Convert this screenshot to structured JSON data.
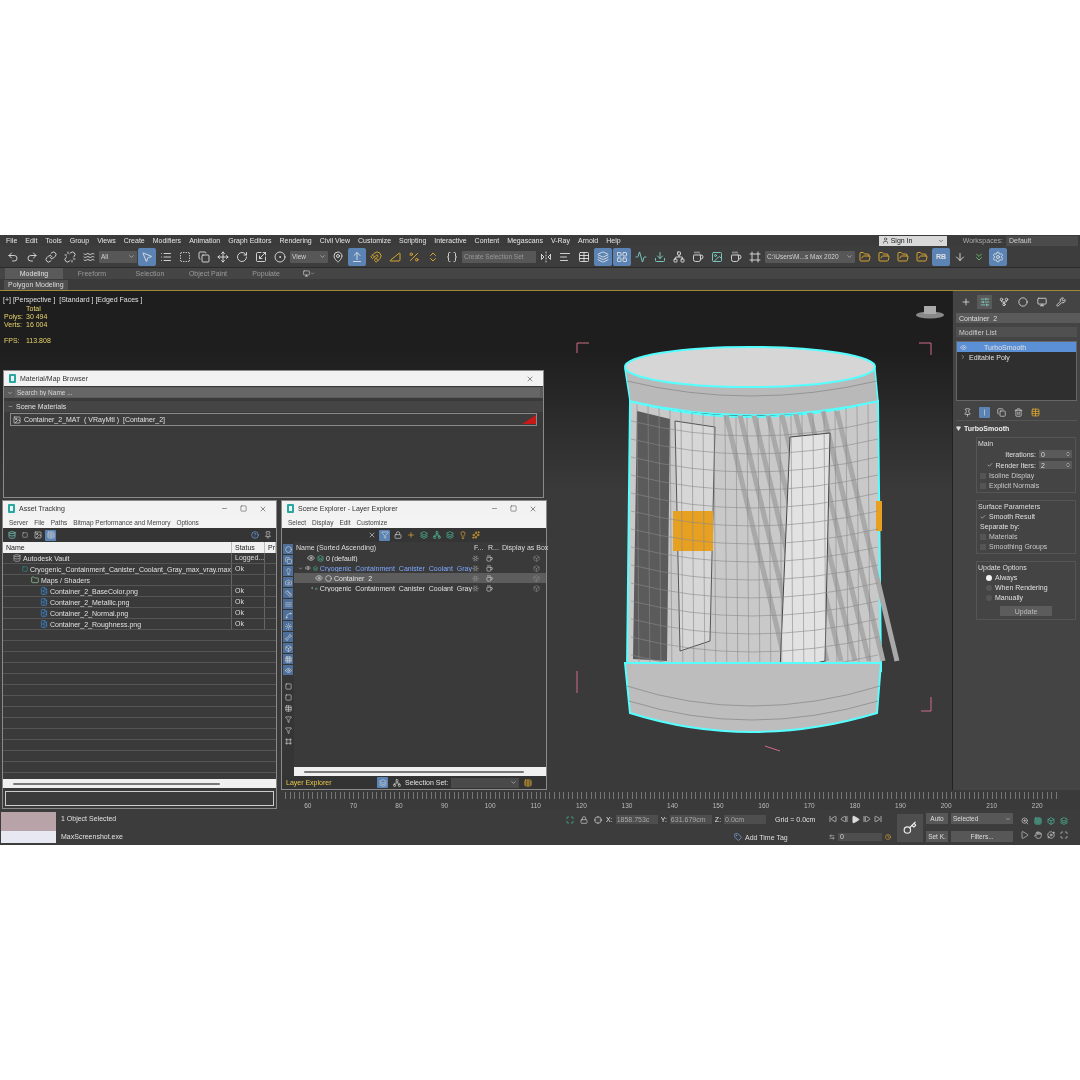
{
  "menu": [
    "File",
    "Edit",
    "Tools",
    "Group",
    "Views",
    "Create",
    "Modifiers",
    "Animation",
    "Graph Editors",
    "Rendering",
    "Civil View",
    "Customize",
    "Scripting",
    "Interactive",
    "Content",
    "Megascans",
    "V-Ray",
    "Arnold",
    "Help"
  ],
  "sign_in": "Sign In",
  "workspaces": {
    "label": "Workspaces:",
    "value": "Default"
  },
  "toolbar": [
    {
      "kind": "undo",
      "on": false
    },
    {
      "kind": "redo",
      "on": false
    },
    {
      "kind": "link",
      "on": false
    },
    {
      "kind": "unlink",
      "on": false
    },
    {
      "kind": "bind",
      "on": false
    },
    {
      "kind": "dropdown",
      "value": "All",
      "on": false
    },
    {
      "kind": "select",
      "on": true
    },
    {
      "kind": "select_by_name",
      "on": false
    },
    {
      "kind": "region",
      "on": false
    },
    {
      "kind": "crossing",
      "on": false
    },
    {
      "kind": "move",
      "on": false
    },
    {
      "kind": "rotate",
      "on": false
    },
    {
      "kind": "scale",
      "on": false
    },
    {
      "kind": "place",
      "on": false
    },
    {
      "kind": "dropdown",
      "value": "View",
      "on": false
    },
    {
      "kind": "pivot",
      "on": false
    },
    {
      "kind": "manipulate",
      "on": true
    },
    {
      "kind": "snap",
      "on": false
    },
    {
      "kind": "angle_snap",
      "on": false
    },
    {
      "kind": "percent_snap",
      "on": false
    },
    {
      "kind": "spinner_snap",
      "on": false
    },
    {
      "kind": "named_sets",
      "on": false
    },
    {
      "kind": "combo",
      "placeholder": "Create Selection Set",
      "on": false
    },
    {
      "kind": "mirror",
      "on": false
    },
    {
      "kind": "align",
      "on": false
    },
    {
      "kind": "table",
      "on": false
    },
    {
      "kind": "layers",
      "on": true
    },
    {
      "kind": "grid",
      "on": true
    },
    {
      "kind": "curve",
      "on": false
    },
    {
      "kind": "dope",
      "on": false
    },
    {
      "kind": "schematic",
      "on": false
    },
    {
      "kind": "teapot",
      "on": false
    },
    {
      "kind": "image",
      "on": false
    },
    {
      "kind": "teapot",
      "on": false
    },
    {
      "kind": "frame",
      "on": false
    },
    {
      "kind": "dropdown",
      "value": "C:\\Users\\M...s Max 2020",
      "on": false
    },
    {
      "kind": "folder",
      "on": false
    },
    {
      "kind": "folder",
      "on": false
    },
    {
      "kind": "folder",
      "on": false
    },
    {
      "kind": "folder",
      "on": false
    },
    {
      "kind": "badge",
      "label": "RB",
      "on": true
    },
    {
      "kind": "down",
      "on": false
    },
    {
      "kind": "chevrons",
      "on": false
    },
    {
      "kind": "settings",
      "on": true
    }
  ],
  "ribbon_tabs": [
    {
      "label": "Modeling",
      "selected": true
    },
    {
      "label": "Freeform",
      "selected": false
    },
    {
      "label": "Selection",
      "selected": false
    },
    {
      "label": "Object Paint",
      "selected": false
    },
    {
      "label": "Populate",
      "selected": false
    }
  ],
  "ribbon_panel": "Polygon Modeling",
  "viewport": {
    "label": "[+] [Perspective ]  [Standard ] [Edged Faces ]",
    "stats_header": "Total",
    "stats": [
      {
        "label": "Polys:",
        "value": "30 494"
      },
      {
        "label": "Verts:",
        "value": "16 004"
      },
      {
        "label": "FPS:",
        "value": "113.808"
      }
    ]
  },
  "material_browser": {
    "title": "Material/Map Browser",
    "search_placeholder": "Search by Name ...",
    "group": "Scene Materials",
    "materials": [
      "Container_2_MAT  ( VRayMtl )  [Container_2]"
    ]
  },
  "asset_tracking": {
    "title": "Asset Tracking",
    "menu": [
      "Server",
      "File",
      "Paths",
      "Bitmap Performance and Memory",
      "Options"
    ],
    "columns": [
      "Name",
      "Status",
      "Pr"
    ],
    "tree": [
      {
        "name": "Autodesk Vault",
        "kind": "vault",
        "status": "Logged...",
        "children": [
          {
            "name": "Cryogenic_Containment_Canister_Coolant_Gray_max_vray.max",
            "kind": "scene",
            "status": "Ok",
            "children": [
              {
                "name": "Maps / Shaders",
                "kind": "folder",
                "children": [
                  {
                    "name": "Container_2_BaseColor.png",
                    "kind": "image",
                    "status": "Ok"
                  },
                  {
                    "name": "Container_2_Metallic.png",
                    "kind": "image",
                    "status": "Ok"
                  },
                  {
                    "name": "Container_2_Normal.png",
                    "kind": "image",
                    "status": "Ok"
                  },
                  {
                    "name": "Container_2_Roughness.png",
                    "kind": "image",
                    "status": "Ok"
                  }
                ]
              }
            ]
          }
        ]
      }
    ]
  },
  "scene_explorer": {
    "title": "Scene Explorer - Layer Explorer",
    "menu": [
      "Select",
      "Display",
      "Edit",
      "Customize"
    ],
    "columns": [
      "Name (Sorted Ascending)",
      "F...",
      "R...",
      "Display as Box"
    ],
    "rows": [
      {
        "name": "0 (default)",
        "kind": "layer",
        "selected": false,
        "current": false
      },
      {
        "name": "Cryogenic_Containment_Canister_Coolant_Gray",
        "kind": "layer",
        "selected": false,
        "current": true,
        "expanded": true,
        "children": [
          {
            "name": "Container_2",
            "kind": "object",
            "selected": true,
            "current": false
          },
          {
            "name": "Cryogenic_Containment_Canister_Coolant_Gray",
            "kind": "group",
            "selected": false,
            "current": false
          }
        ]
      }
    ],
    "footer_explorer": "Layer Explorer",
    "selection_set_label": "Selection Set:"
  },
  "command_panel": {
    "tabs": [
      {
        "kind": "create",
        "selected": false
      },
      {
        "kind": "modify",
        "selected": true
      },
      {
        "kind": "hierarchy",
        "selected": false
      },
      {
        "kind": "motion",
        "selected": false
      },
      {
        "kind": "display",
        "selected": false
      },
      {
        "kind": "utilities",
        "selected": false
      }
    ],
    "object_name": "Container_2",
    "modifier_list": "Modifier List",
    "modifiers": [
      {
        "name": "TurboSmooth",
        "selected": true
      },
      {
        "name": "Editable Poly",
        "selected": false
      }
    ],
    "rollout_title": "TurboSmooth",
    "groups": [
      {
        "title": "Main",
        "items": [
          {
            "kind": "spinner",
            "label": "Iterations:",
            "value": "0"
          },
          {
            "kind": "checkbox_spinner",
            "label": "Render Iters:",
            "value": "2",
            "checked": true
          },
          {
            "kind": "checkbox",
            "label": "Isoline Display",
            "checked": false
          },
          {
            "kind": "checkbox",
            "label": "Explicit Normals",
            "checked": false
          }
        ]
      },
      {
        "title": "Surface Parameters",
        "items": [
          {
            "kind": "checkbox",
            "label": "Smooth Result",
            "checked": true
          },
          {
            "kind": "label",
            "label": "Separate by:"
          },
          {
            "kind": "checkbox",
            "label": "Materials",
            "checked": false
          },
          {
            "kind": "checkbox",
            "label": "Smoothing Groups",
            "checked": false
          }
        ]
      },
      {
        "title": "Update Options",
        "items": [
          {
            "kind": "radio",
            "label": "Always",
            "selected": true
          },
          {
            "kind": "radio",
            "label": "When Rendering",
            "selected": false
          },
          {
            "kind": "radio",
            "label": "Manually",
            "selected": false
          },
          {
            "kind": "button",
            "label": "Update"
          }
        ]
      }
    ]
  },
  "timeline": {
    "ticks": [
      "60",
      "70",
      "80",
      "90",
      "100",
      "110",
      "120",
      "130",
      "140",
      "150",
      "160",
      "170",
      "180",
      "190",
      "200",
      "210",
      "220"
    ]
  },
  "status_bar": {
    "selection": "1 Object Selected",
    "process": "MaxScreenshot.exe",
    "x_label": "X:",
    "x": "1858.753c",
    "y_label": "Y:",
    "y": "631.679cm",
    "z_label": "Z:",
    "z": "0.0cm",
    "grid": "Grid = 0.0cm",
    "time_tag": "Add Time Tag",
    "frame": "0",
    "auto": "Auto",
    "set_key": "Set K.",
    "key_filter": "Selected",
    "filters": "Filters..."
  }
}
